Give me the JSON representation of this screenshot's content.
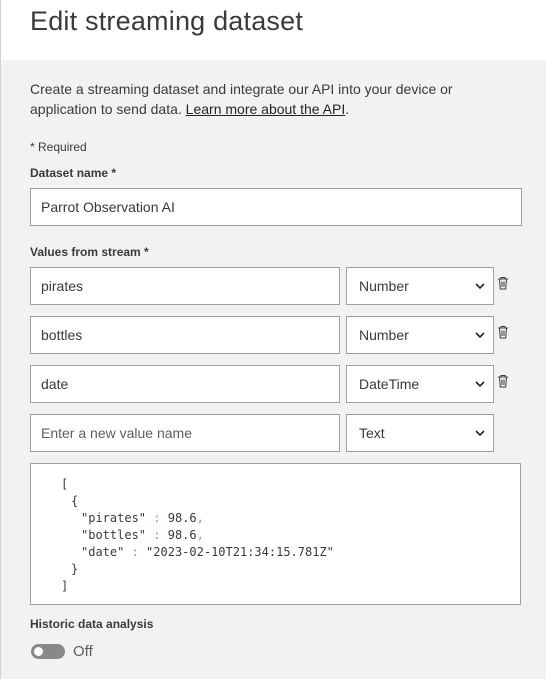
{
  "header": {
    "title": "Edit streaming dataset"
  },
  "intro": {
    "text": "Create a streaming dataset and integrate our API into your device or application to send data. ",
    "link": "Learn more about the API",
    "suffix": "."
  },
  "required_note": "* Required",
  "dataset_name": {
    "label": "Dataset name *",
    "value": "Parrot Observation AI"
  },
  "values": {
    "label": "Values from stream *",
    "rows": [
      {
        "name": "pirates",
        "type": "Number"
      },
      {
        "name": "bottles",
        "type": "Number"
      },
      {
        "name": "date",
        "type": "DateTime"
      }
    ],
    "new_row": {
      "placeholder": "Enter a new value name",
      "type": "Text"
    }
  },
  "json_preview": {
    "open_bracket": "[",
    "open_brace": "{",
    "lines": [
      {
        "key": "\"pirates\"",
        "sep": " : ",
        "val": "98.6",
        "comma": ","
      },
      {
        "key": "\"bottles\"",
        "sep": " : ",
        "val": "98.6",
        "comma": ","
      },
      {
        "key": "\"date\"",
        "sep": " : ",
        "val": "\"2023-02-10T21:34:15.781Z\"",
        "comma": ""
      }
    ],
    "close_brace": "}",
    "close_bracket": "]"
  },
  "historic": {
    "label": "Historic data analysis",
    "toggle_state": "Off"
  },
  "colors": {
    "accent_punct": "#e8864a",
    "toggle_off": "#8a8886"
  },
  "icons": {
    "delete": "trash-icon",
    "dropdown": "chevron-down-icon"
  }
}
